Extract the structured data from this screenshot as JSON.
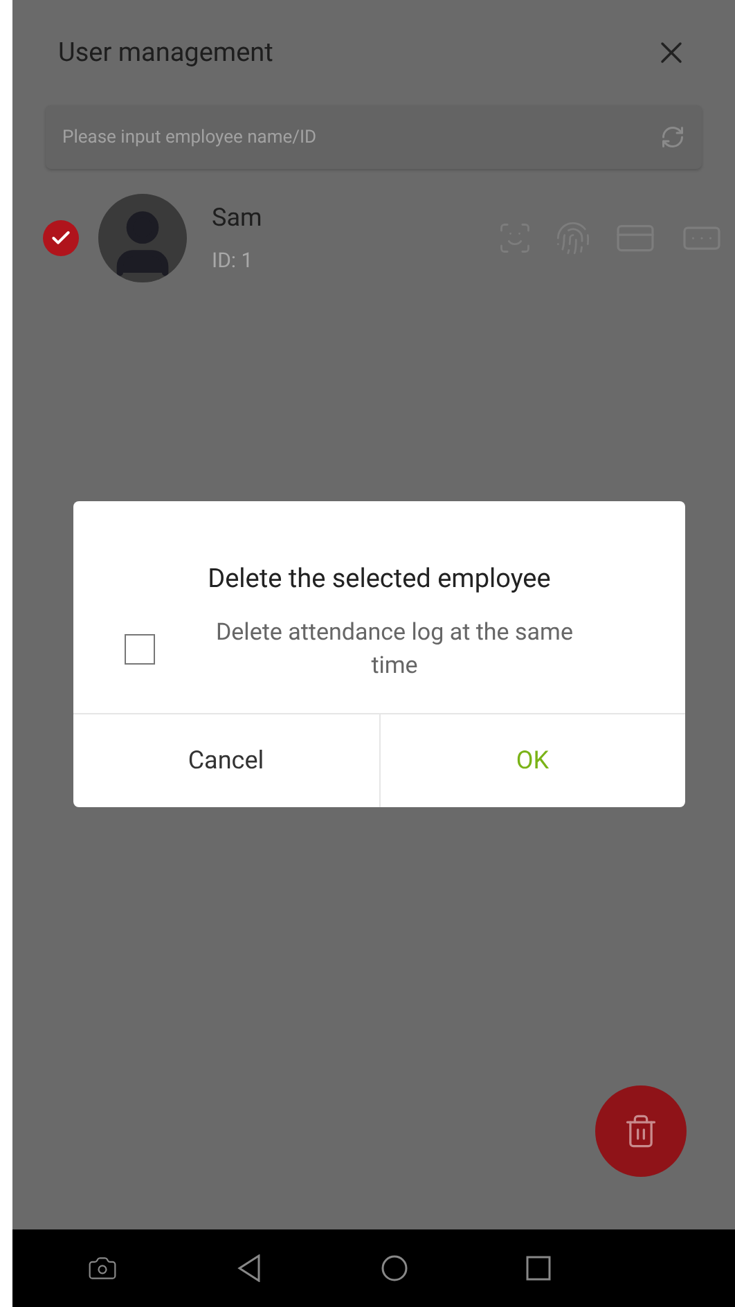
{
  "header": {
    "title": "User management"
  },
  "search": {
    "placeholder": "Please input employee name/ID"
  },
  "employees": [
    {
      "name": "Sam",
      "id": "ID: 1",
      "selected": true
    }
  ],
  "dialog": {
    "title": "Delete the selected employee",
    "option": {
      "label": "Delete attendance log at the same time",
      "checked": false
    },
    "buttons": [
      {
        "label": "Cancel",
        "kind": "cancel"
      },
      {
        "label": "OK",
        "kind": "confirm"
      }
    ]
  }
}
